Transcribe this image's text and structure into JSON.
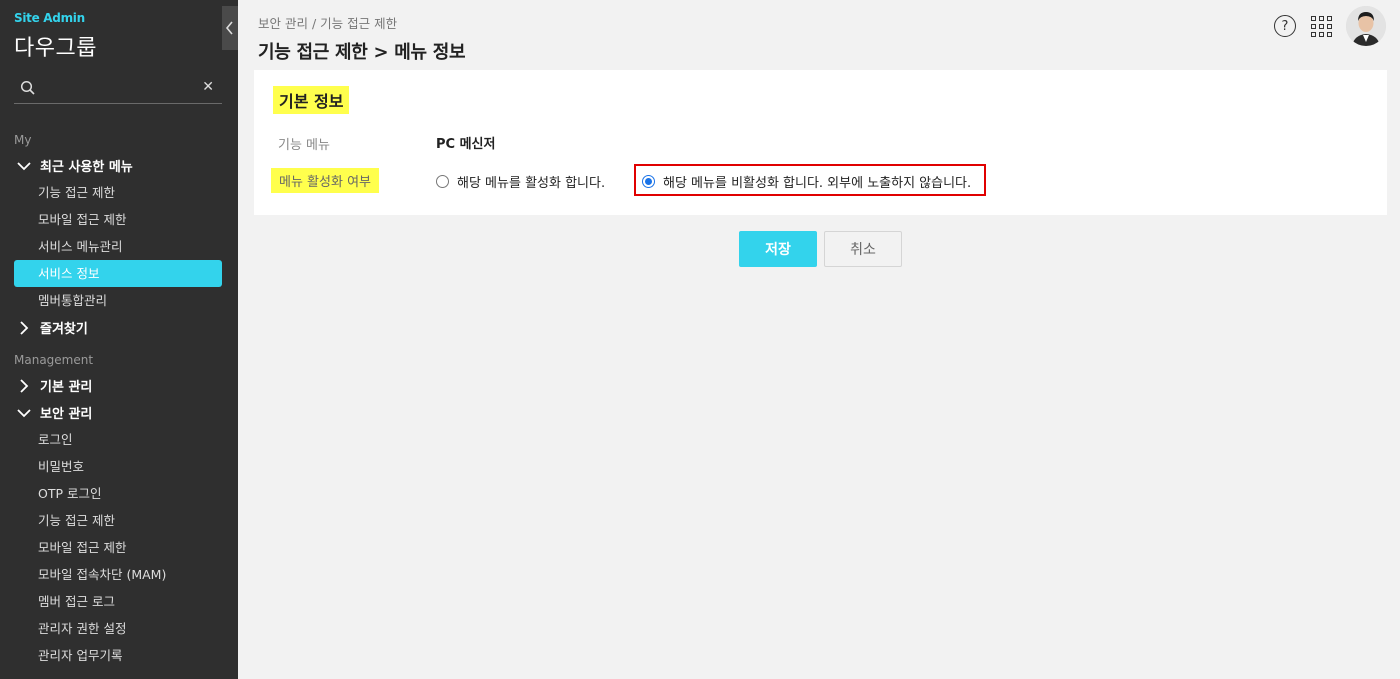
{
  "sidebar": {
    "site_admin": "Site Admin",
    "org_name": "다우그룹",
    "search_placeholder": "",
    "section_my": "My",
    "recent_menu": "최근 사용한 메뉴",
    "recent_items": [
      "기능 접근 제한",
      "모바일 접근 제한",
      "서비스 메뉴관리",
      "서비스 정보",
      "멤버통합관리"
    ],
    "favorites": "즐겨찾기",
    "section_management": "Management",
    "basic_mgmt": "기본 관리",
    "security_mgmt": "보안 관리",
    "security_items": [
      "로그인",
      "비밀번호",
      "OTP 로그인",
      "기능 접근 제한",
      "모바일 접근 제한",
      "모바일 접속차단 (MAM)",
      "멤버 접근 로그",
      "관리자 권한 설정",
      "관리자 업무기록"
    ]
  },
  "header": {
    "breadcrumb": "보안 관리 / 기능 접근 제한",
    "title": "기능 접근 제한 > 메뉴 정보",
    "help_glyph": "?"
  },
  "card": {
    "section_title": "기본 정보",
    "func_menu_label": "기능 메뉴",
    "func_menu_value": "PC 메신저",
    "activation_label": "메뉴 활성화 여부",
    "option_activate": "해당 메뉴를 활성화 합니다.",
    "option_deactivate": "해당 메뉴를 비활성화 합니다. 외부에 노출하지 않습니다.",
    "selected_option": "deactivate"
  },
  "buttons": {
    "save": "저장",
    "cancel": "취소"
  },
  "colors": {
    "accent": "#33d3ec",
    "highlight": "#ffff4d",
    "sidebar_bg": "#2f2f2f",
    "box_red": "#e00000"
  }
}
